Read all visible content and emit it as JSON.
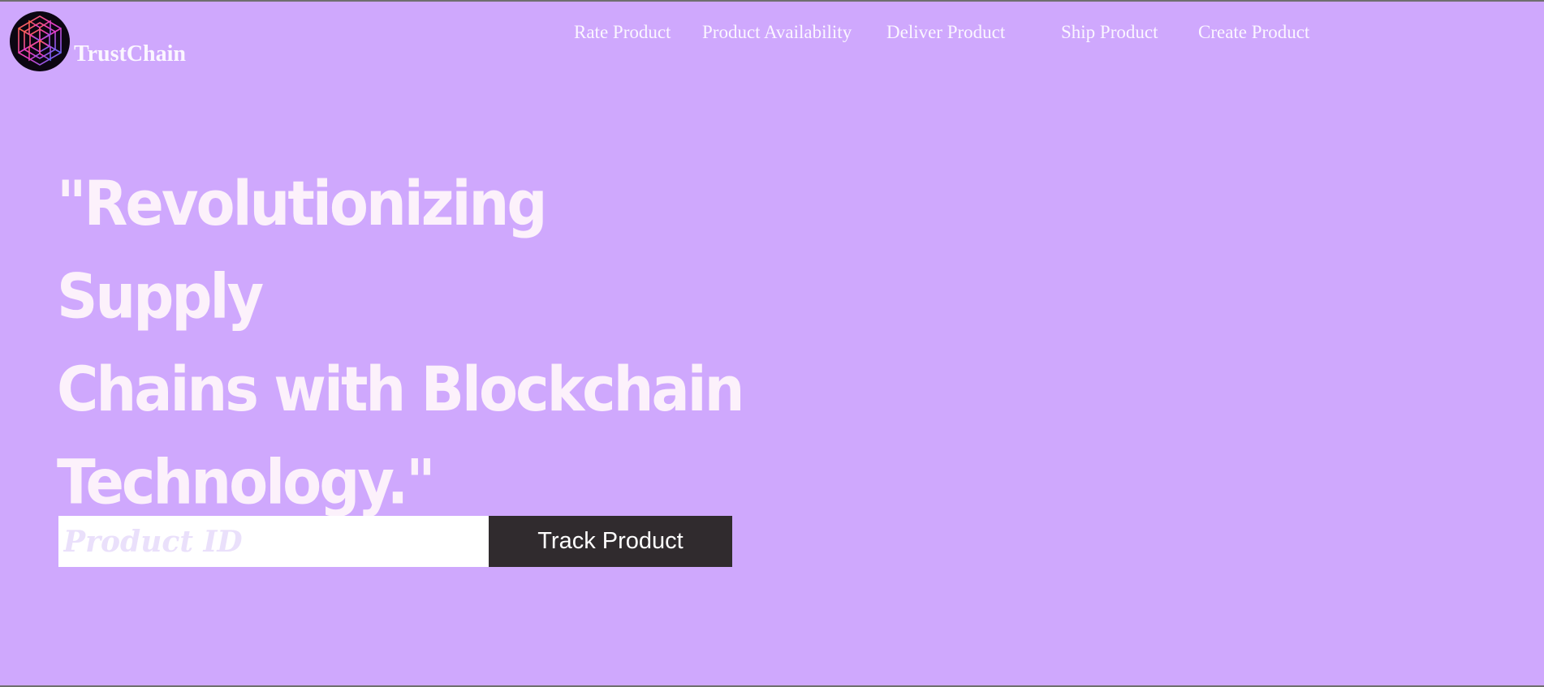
{
  "brand": {
    "name": "TrustChain",
    "logo_icon": "hexagonal-cube-logo-icon"
  },
  "nav": {
    "items": [
      {
        "label": "Rate Product"
      },
      {
        "label": "Product Availability"
      },
      {
        "label": "Deliver Product"
      },
      {
        "label": "Ship Product"
      },
      {
        "label": "Create Product"
      }
    ]
  },
  "hero": {
    "line1": "\"Revolutionizing Supply",
    "line2": "Chains with Blockchain",
    "line3": "Technology.\""
  },
  "track": {
    "input_value": "",
    "input_placeholder": "Product ID",
    "button_label": "Track Product"
  },
  "colors": {
    "background": "#cfa8fd",
    "text_light": "#fcf1fb",
    "button_bg": "#302b2e",
    "logo_bg": "#0c0612"
  }
}
